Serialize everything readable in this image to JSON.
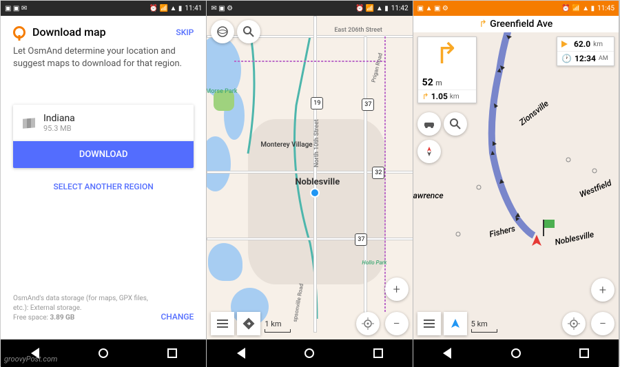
{
  "status": {
    "time1": "11:41",
    "time2": "11:42",
    "time3": "11:45"
  },
  "pane1": {
    "title": "Download map",
    "skip": "SKIP",
    "desc": "Let OsmAnd determine your location and suggest maps to download for that region.",
    "region_name": "Indiana",
    "region_size": "95.3 MB",
    "download_btn": "DOWNLOAD",
    "select_another": "SELECT ANOTHER REGION",
    "storage_text": "OsmAnd's data storage (for maps, GPX files, etc.): External storage.",
    "free_space_label": "Free space: ",
    "free_space": "3.89 GB",
    "change": "CHANGE"
  },
  "pane2": {
    "labels": {
      "east206": "East 206th Street",
      "morse": "Morse Park",
      "monterey": "Monterey Village",
      "noblesville": "Noblesville",
      "n10th": "North 10th Street",
      "prigan": "Prigan Road",
      "spsonville": "spsonville Road",
      "hollopark": "Hollo Park"
    },
    "shields": {
      "s19": "19",
      "s37a": "37",
      "s32": "32",
      "s37b": "37"
    },
    "scale": "1 km"
  },
  "pane3": {
    "title": "Greenfield Ave",
    "dist_value": "52",
    "dist_unit": "m",
    "next_value": "1.05",
    "next_unit": "km",
    "remaining_value": "62.0",
    "remaining_unit": "km",
    "eta": "12:34",
    "eta_ampm": "AM",
    "labels": {
      "zionsville": "Zionsville",
      "lawrence": "awrence",
      "fishers": "Fishers",
      "noblesville": "Noblesville",
      "westfield": "Westfield"
    },
    "scale": "5 km"
  },
  "watermark": "groovyPost.com"
}
